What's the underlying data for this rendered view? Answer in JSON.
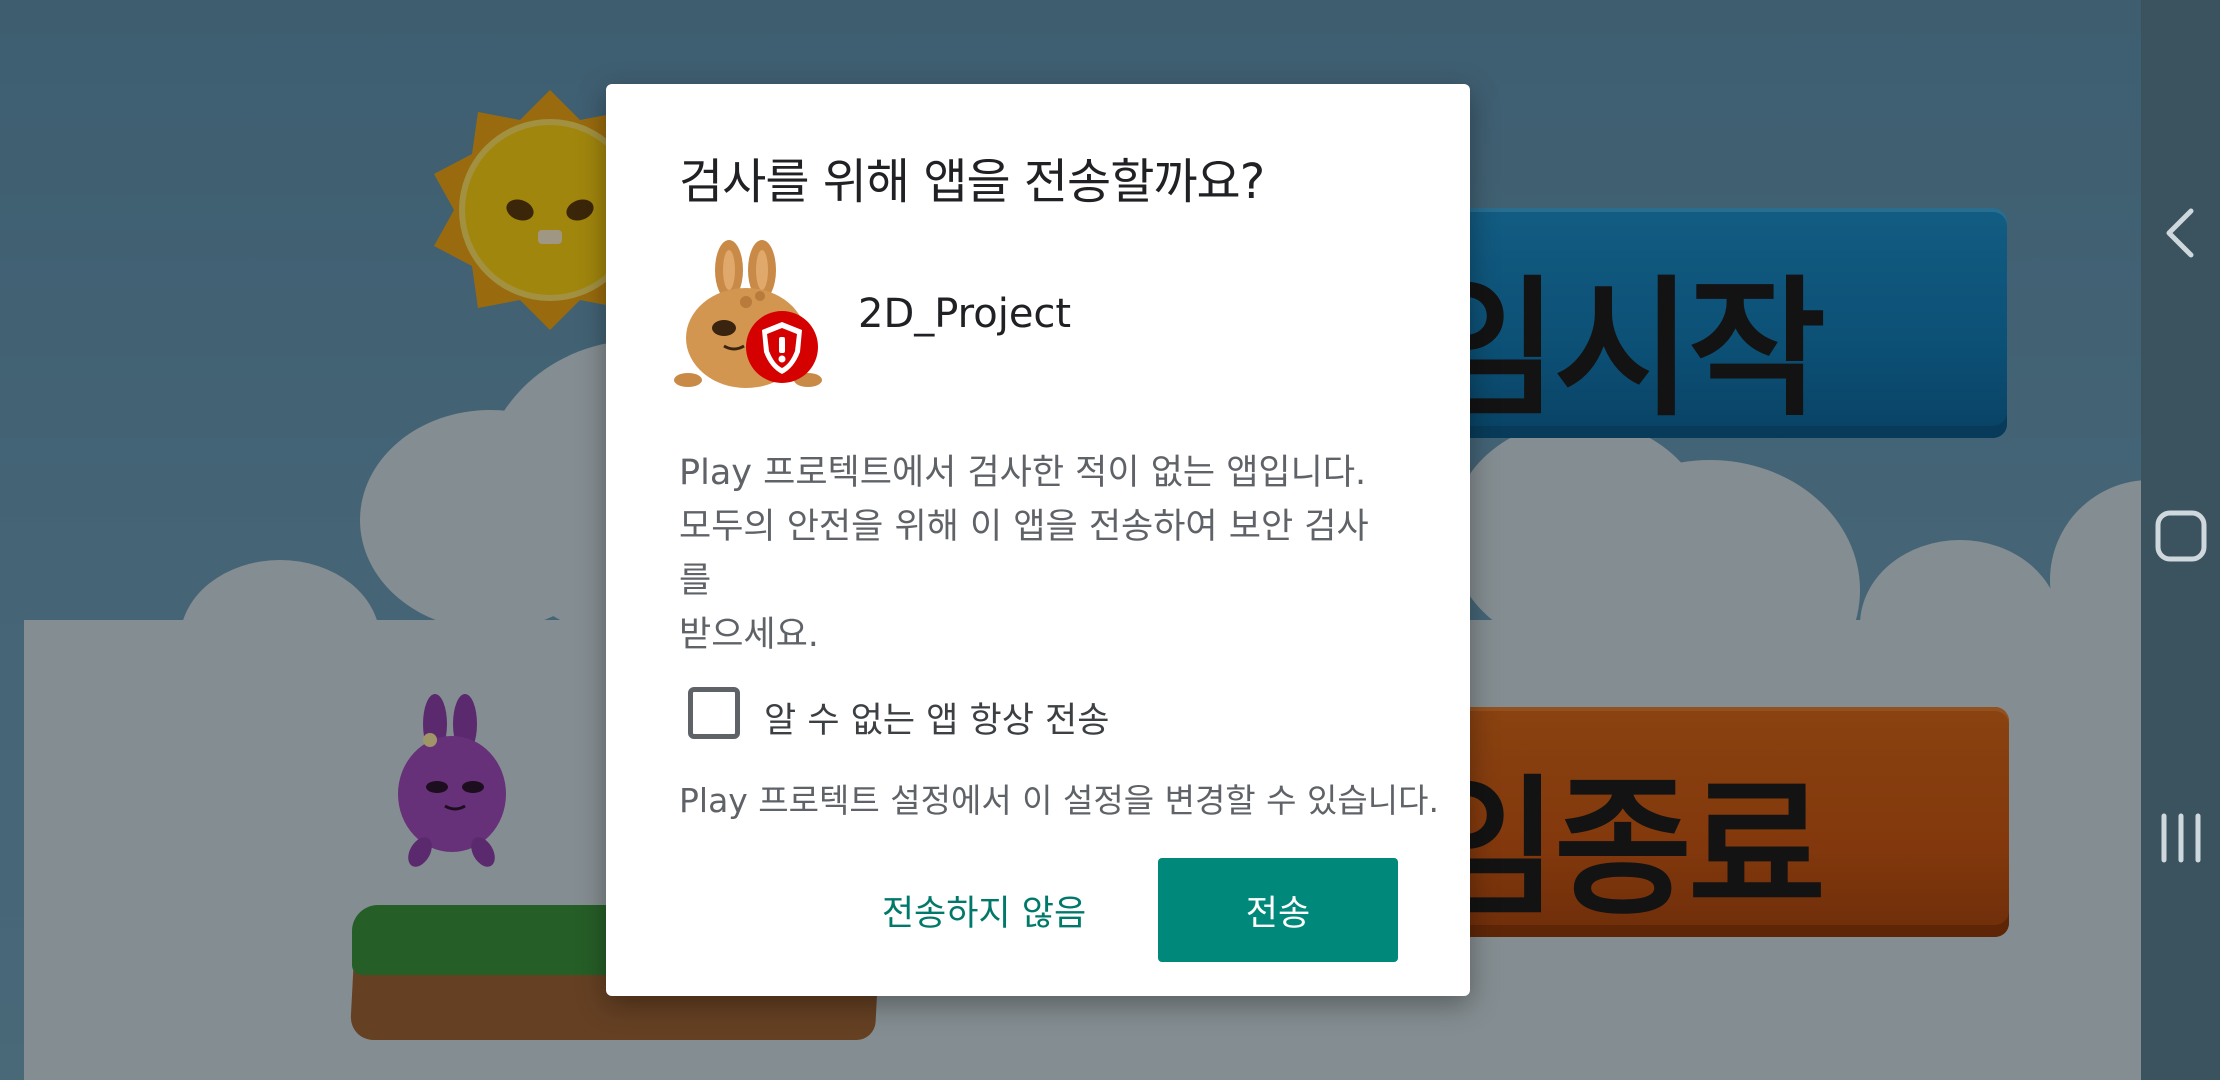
{
  "dialog": {
    "title": "검사를 위해 앱을 전송할까요?",
    "app_name": "2D_Project",
    "body_lines": [
      "Play 프로텍트에서 검사한 적이 없는 앱입니다.",
      "모두의 안전을 위해 이 앱을 전송하여 보안 검사를",
      "받으세요."
    ],
    "checkbox": {
      "label": "알 수 없는 앱 항상 전송",
      "checked": false
    },
    "hint": "Play 프로텍트 설정에서 이 설정을 변경할 수 있습니다.",
    "buttons": {
      "cancel": "전송하지 않음",
      "send": "전송"
    },
    "accent_color": "#00897b",
    "warning_badge_color": "#d50000"
  },
  "background": {
    "start_button_text": "임시작",
    "end_button_text": "임종료"
  },
  "navbar": {
    "icons": [
      "back-icon",
      "home-icon",
      "recents-icon"
    ]
  }
}
